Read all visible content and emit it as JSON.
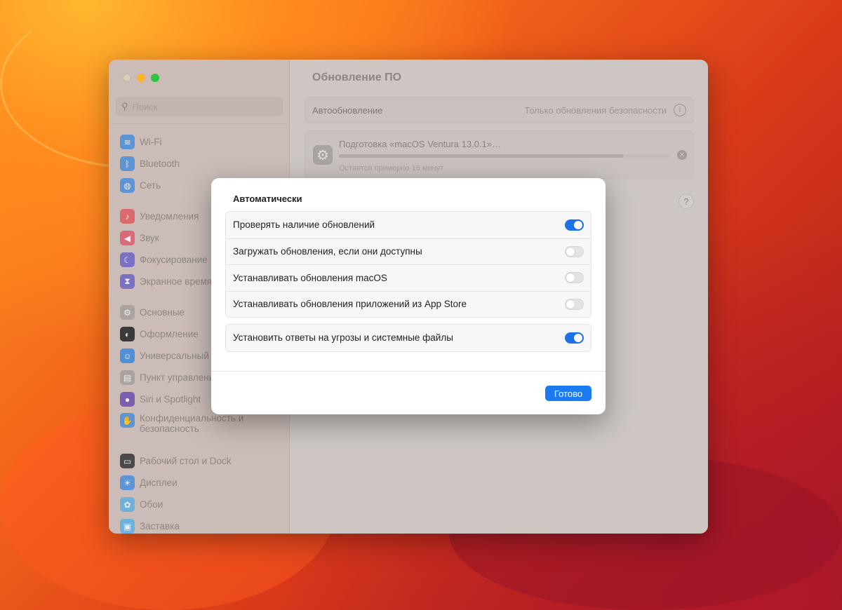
{
  "window": {
    "search_placeholder": "Поиск",
    "title": "Обновление ПО"
  },
  "sidebar": {
    "items": [
      {
        "label": "Wi-Fi",
        "icon": "wifi-icon",
        "color": "#5d94d6"
      },
      {
        "label": "Bluetooth",
        "icon": "bluetooth-icon",
        "color": "#5d94d6"
      },
      {
        "label": "Сеть",
        "icon": "globe-icon",
        "color": "#5d94d6"
      },
      {
        "label": "Уведомления",
        "icon": "bell-icon",
        "color": "#d96a6d"
      },
      {
        "label": "Звук",
        "icon": "speaker-icon",
        "color": "#d96a7a"
      },
      {
        "label": "Фокусирование",
        "icon": "moon-icon",
        "color": "#7a71c4"
      },
      {
        "label": "Экранное время",
        "icon": "hourglass-icon",
        "color": "#7a71c4"
      },
      {
        "label": "Основные",
        "icon": "gear-icon",
        "color": "#aaa3a0"
      },
      {
        "label": "Оформление",
        "icon": "appearance-icon",
        "color": "#3a3a3a"
      },
      {
        "label": "Универсальный доступ",
        "icon": "accessibility-icon",
        "color": "#4f8fd8"
      },
      {
        "label": "Пункт управления",
        "icon": "control-center-icon",
        "color": "#aaa3a0"
      },
      {
        "label": "Siri и Spotlight",
        "icon": "siri-icon",
        "color": "#7a5fb0"
      },
      {
        "label": "Конфиденциальность и безопасность",
        "icon": "hand-icon",
        "color": "#5d94d6"
      },
      {
        "label": "Рабочий стол и Dock",
        "icon": "dock-icon",
        "color": "#4a4a4a"
      },
      {
        "label": "Дисплеи",
        "icon": "sun-icon",
        "color": "#5d94d6"
      },
      {
        "label": "Обои",
        "icon": "flower-icon",
        "color": "#6fb1dd"
      },
      {
        "label": "Заставка",
        "icon": "screensaver-icon",
        "color": "#6fb1dd"
      }
    ]
  },
  "main": {
    "auto_update_label": "Автообновление",
    "auto_update_value": "Только обновления безопасности",
    "download_title": "Подготовка «macOS Ventura 13.0.1»…",
    "download_status": "Остается примерно 15 минут",
    "progress": 0.86,
    "help": "?"
  },
  "dialog": {
    "title": "Автоматически",
    "options": [
      {
        "label": "Проверять наличие обновлений",
        "on": true
      },
      {
        "label": "Загружать обновления, если они доступны",
        "on": false
      },
      {
        "label": "Устанавливать обновления macOS",
        "on": false
      },
      {
        "label": "Устанавливать обновления приложений из App Store",
        "on": false
      }
    ],
    "security": {
      "label": "Установить ответы на угрозы и системные файлы",
      "on": true
    },
    "done_label": "Готово"
  },
  "colors": {
    "accent": "#1d7bf2"
  }
}
